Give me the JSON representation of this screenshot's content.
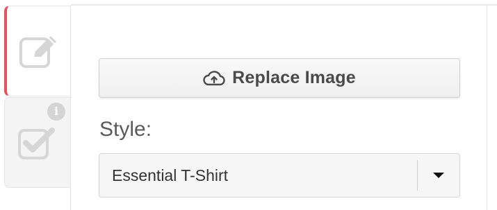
{
  "tabs": [
    {
      "icon": "edit-icon",
      "active": true
    },
    {
      "icon": "checkbox-icon",
      "active": false,
      "badge": "i"
    }
  ],
  "colors": {
    "active_accent": "#e8505b",
    "icon_gray": "#d6d6d6",
    "button_text": "#4a4a4a"
  },
  "editor": {
    "replace_button": {
      "label": "Replace Image",
      "icon": "cloud-upload-icon"
    },
    "style": {
      "label": "Style:",
      "selected": "Essential T-Shirt",
      "caret_icon": "caret-down-icon"
    }
  }
}
